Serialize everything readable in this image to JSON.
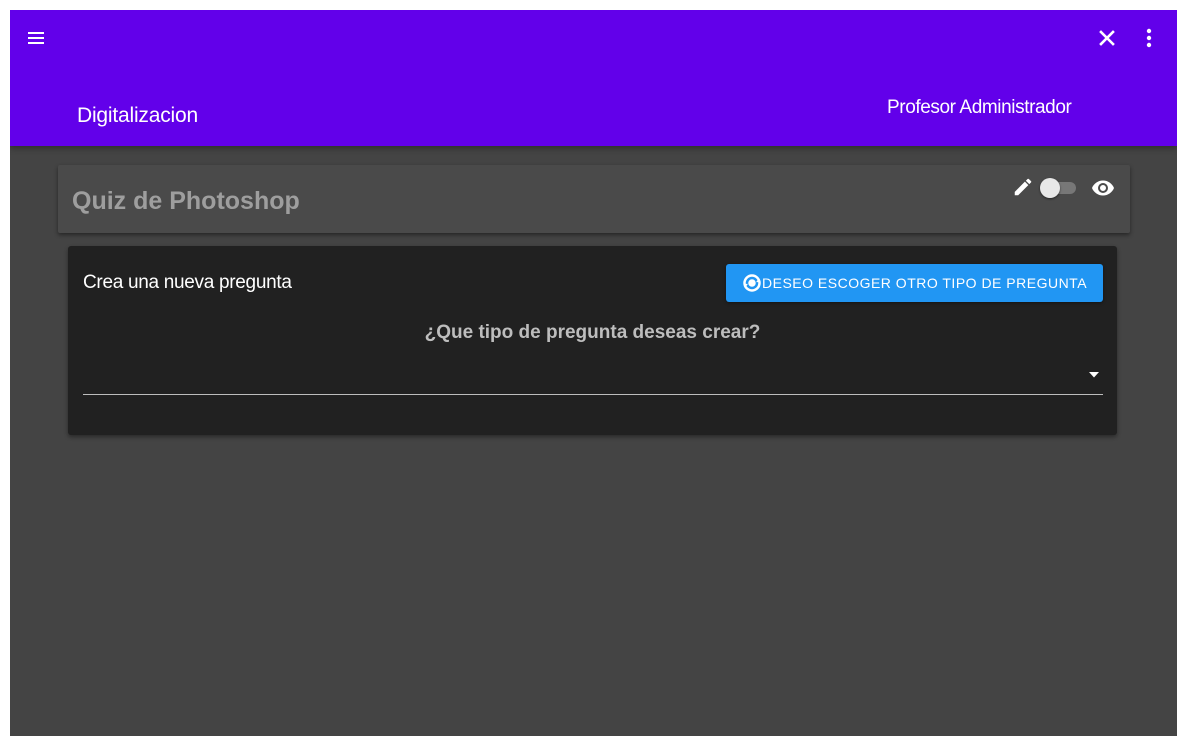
{
  "app_bar": {
    "title": "Digitalizacion",
    "user_name": "Profesor Administrador",
    "color": "#6200ea",
    "icons": {
      "menu": "menu-icon",
      "close": "close-icon",
      "more": "more-vertical-icon"
    }
  },
  "quiz_header": {
    "title": "Quiz de Photoshop",
    "icons": {
      "edit": "pencil-icon",
      "visibility": "eye-icon"
    },
    "toggle_on": false
  },
  "question_card": {
    "heading": "Crea una nueva pregunta",
    "switch_type_button": {
      "label": "DESEO ESCOGER OTRO TIPO DE PREGUNTA",
      "icon": "switch-type-icon",
      "color": "#2196f3"
    },
    "question_type_label": "¿Que tipo de pregunta deseas crear?",
    "question_type_select": {
      "value": ""
    }
  },
  "theme": {
    "background": "#444444",
    "card_background": "#212121"
  }
}
